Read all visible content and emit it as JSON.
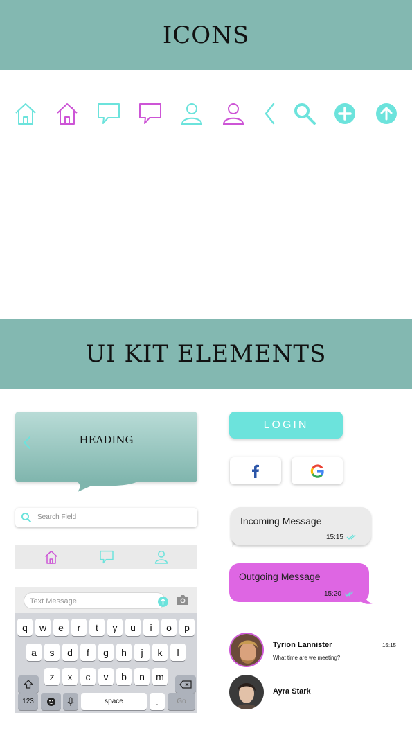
{
  "sections": {
    "icons_title": "ICONS",
    "kit_title": "UI KIT ELEMENTS"
  },
  "icons": [
    {
      "name": "home-icon",
      "color": "#6ce3dc"
    },
    {
      "name": "home-icon",
      "color": "#cd55d6"
    },
    {
      "name": "chat-icon",
      "color": "#6ce3dc"
    },
    {
      "name": "chat-icon",
      "color": "#cd55d6"
    },
    {
      "name": "user-icon",
      "color": "#6ce3dc"
    },
    {
      "name": "user-icon",
      "color": "#cd55d6"
    },
    {
      "name": "chevron-left-icon",
      "color": "#6ce3dc"
    },
    {
      "name": "search-icon",
      "color": "#6ce3dc"
    },
    {
      "name": "plus-circle-icon",
      "color": "#6ce3dc"
    },
    {
      "name": "arrow-up-circle-icon",
      "color": "#6ce3dc"
    }
  ],
  "header": {
    "title": "HEADING"
  },
  "search": {
    "placeholder": "Search Field"
  },
  "tabbar": {
    "items": [
      "home-icon",
      "chat-icon",
      "user-icon"
    ]
  },
  "keyboard": {
    "placeholder": "Text Message",
    "row1": [
      "q",
      "w",
      "e",
      "r",
      "t",
      "y",
      "u",
      "i",
      "o",
      "p"
    ],
    "row2": [
      "a",
      "s",
      "d",
      "f",
      "g",
      "h",
      "j",
      "k",
      "l"
    ],
    "row3": [
      "z",
      "x",
      "c",
      "v",
      "b",
      "n",
      "m"
    ],
    "numbers_key": "123",
    "space_key": "space",
    "period_key": ".",
    "go_key": "Go"
  },
  "login": {
    "label": "LOGIN"
  },
  "social": [
    "facebook-icon",
    "google-icon"
  ],
  "messages": {
    "incoming": {
      "text": "Incoming Message",
      "time": "15:15"
    },
    "outgoing": {
      "text": "Outgoing Message",
      "time": "15:20"
    }
  },
  "contacts": [
    {
      "name": "Tyrion Lannister",
      "preview": "What time are we meeting?",
      "time": "15:15"
    },
    {
      "name": "Ayra Stark"
    }
  ],
  "colors": {
    "accent": "#6ce3dc",
    "purple": "#cd55d6",
    "banner": "#83b8b1",
    "outgoing": "#de66e3"
  }
}
